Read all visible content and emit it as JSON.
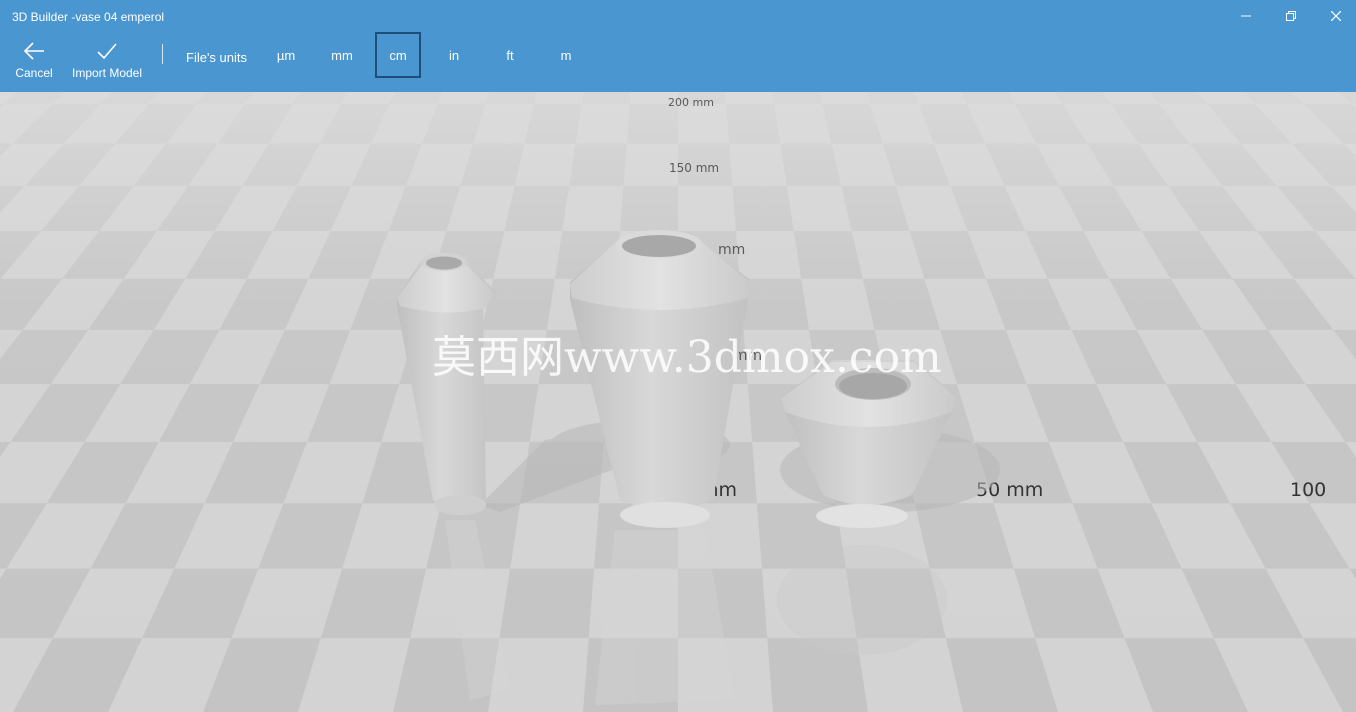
{
  "window": {
    "title": "3D Builder -vase 04 emperol",
    "controls": [
      "minimize",
      "restore",
      "close"
    ]
  },
  "toolbar": {
    "cancel_label": "Cancel",
    "import_label": "Import Model",
    "units_label": "File's units",
    "units": [
      "µm",
      "mm",
      "cm",
      "in",
      "ft",
      "m"
    ],
    "selected_unit": "cm"
  },
  "scene": {
    "ruler_labels": {
      "r200": "200 mm",
      "r150": "150 mm",
      "r100": "mm",
      "r50v": "mm",
      "r0": "mm",
      "r50": "50 mm",
      "r100h": "100"
    },
    "watermark": "莫西网www.3dmox.com",
    "colors": {
      "toolbar": "#4a96d1",
      "floor_light": "#d4d4d4",
      "floor_dark": "#c4c4c4",
      "vase": "#cfcfcf"
    }
  }
}
